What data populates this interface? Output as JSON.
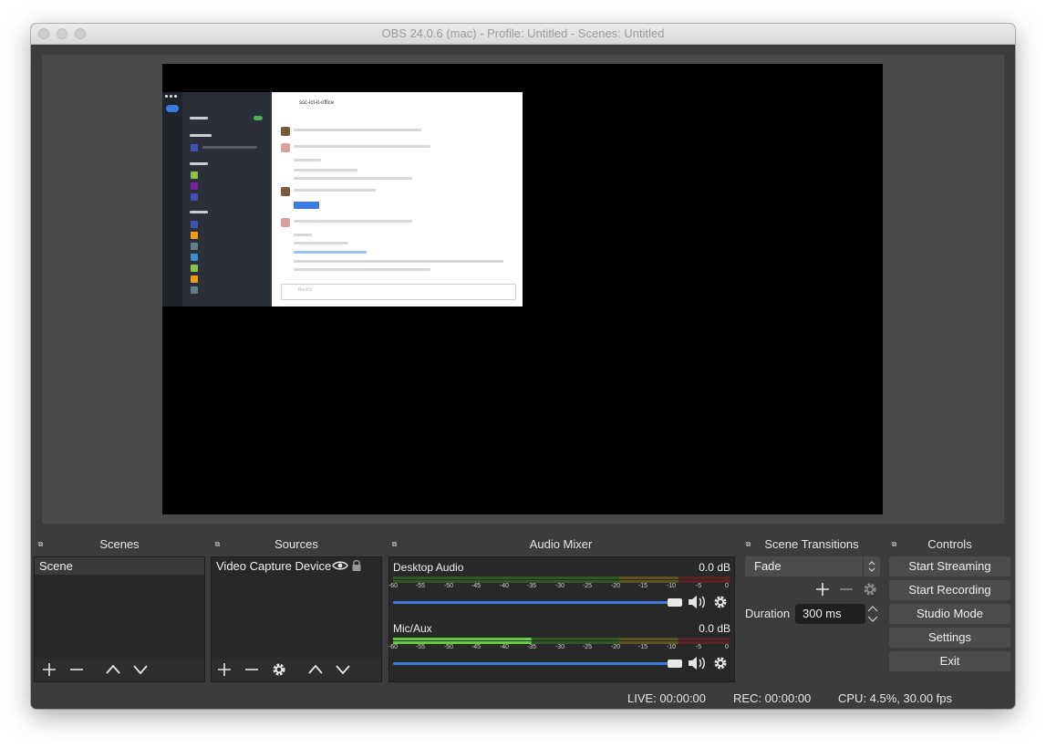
{
  "window": {
    "title": "OBS 24.0.6 (mac) - Profile: Untitled - Scenes: Untitled"
  },
  "preview": {
    "captured_app_title": "ssc-ict-it-office",
    "captured_input_placeholder": "Bericht"
  },
  "docks": {
    "scenes": {
      "title": "Scenes",
      "items": [
        "Scene"
      ]
    },
    "sources": {
      "title": "Sources",
      "items": [
        "Video Capture Device"
      ]
    },
    "audio_mixer": {
      "title": "Audio Mixer",
      "scale": [
        "-60",
        "-55",
        "-50",
        "-45",
        "-40",
        "-35",
        "-30",
        "-25",
        "-20",
        "-15",
        "-10",
        "-5",
        "0"
      ],
      "channels": [
        {
          "name": "Desktop Audio",
          "db": "0.0 dB",
          "level": 0.0,
          "volume": 1.0
        },
        {
          "name": "Mic/Aux",
          "db": "0.0 dB",
          "level": 0.41,
          "volume": 1.0
        }
      ]
    },
    "scene_transitions": {
      "title": "Scene Transitions",
      "transition": "Fade",
      "duration_label": "Duration",
      "duration_value": "300 ms"
    },
    "controls": {
      "title": "Controls",
      "buttons": [
        "Start Streaming",
        "Start Recording",
        "Studio Mode",
        "Settings",
        "Exit"
      ]
    }
  },
  "status_bar": {
    "live": "LIVE: 00:00:00",
    "rec": "REC: 00:00:00",
    "cpu": "CPU: 4.5%, 30.00 fps"
  },
  "colors": {
    "meter_green": "#5fd03a",
    "meter_yellow": "#c8b43a",
    "meter_red": "#c83a3a",
    "slider_blue": "#3b7be0"
  }
}
